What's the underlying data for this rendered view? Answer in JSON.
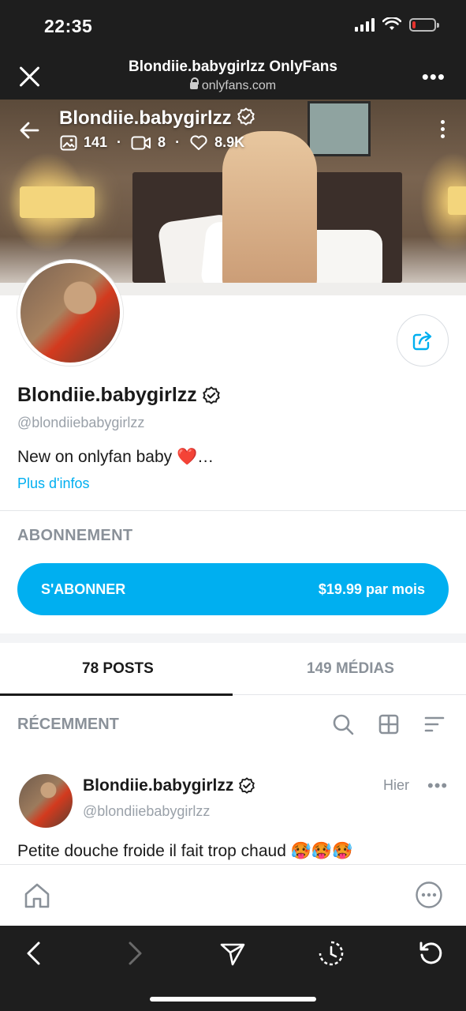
{
  "status_bar": {
    "time": "22:35"
  },
  "browser": {
    "title": "Blondiie.babygirlzz OnlyFans",
    "url": "onlyfans.com"
  },
  "cover": {
    "name": "Blondiie.babygirlzz",
    "stats": {
      "photos": "141",
      "videos": "8",
      "likes": "8.9K"
    }
  },
  "profile": {
    "name": "Blondiie.babygirlzz",
    "handle": "@blondiiebabygirlzz",
    "bio": "New on onlyfan baby ❤️…",
    "more_info_link": "Plus d'infos"
  },
  "subscription": {
    "section_title": "ABONNEMENT",
    "button_label": "S'ABONNER",
    "price": "$19.99 par mois"
  },
  "tabs": [
    {
      "label": "78 POSTS",
      "active": true
    },
    {
      "label": "149 MÉDIAS",
      "active": false
    }
  ],
  "recent": {
    "title": "RÉCEMMENT"
  },
  "post": {
    "author": "Blondiie.babygirlzz",
    "handle": "@blondiiebabygirlzz",
    "time": "Hier",
    "text": "Petite douche froide il fait trop chaud 🥵🥵🥵"
  },
  "colors": {
    "accent": "#00aff0",
    "browser_chrome": "#1e1e1e",
    "muted_text": "#8a9199"
  },
  "battery_level": 0.15
}
